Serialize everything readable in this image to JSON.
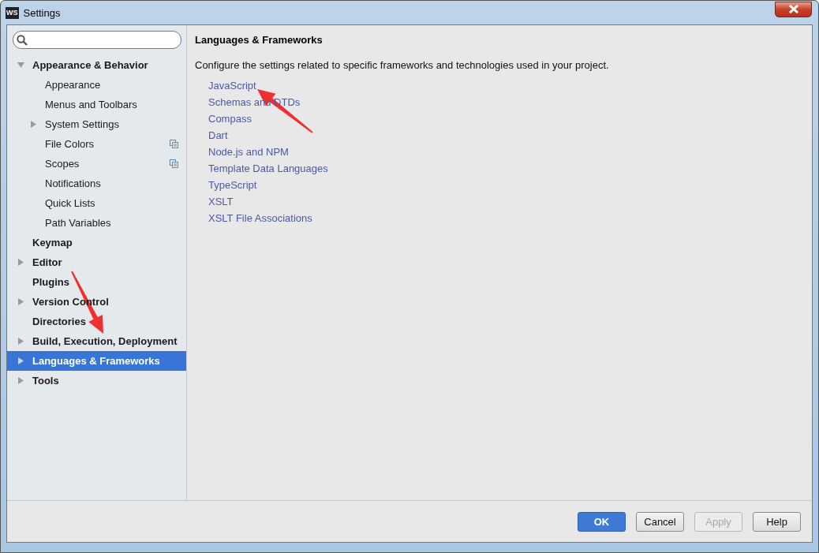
{
  "window": {
    "title": "Settings",
    "app_icon": "WS"
  },
  "sidebar": {
    "items": [
      {
        "label": "Appearance & Behavior",
        "kind": "group",
        "expanded": true,
        "selected": false,
        "children": [
          {
            "label": "Appearance",
            "kind": "leaf",
            "project_icon": false,
            "selected": false
          },
          {
            "label": "Menus and Toolbars",
            "kind": "leaf",
            "project_icon": false,
            "selected": false
          },
          {
            "label": "System Settings",
            "kind": "group",
            "expanded": false,
            "project_icon": false,
            "selected": false
          },
          {
            "label": "File Colors",
            "kind": "leaf",
            "project_icon": true,
            "selected": false
          },
          {
            "label": "Scopes",
            "kind": "leaf",
            "project_icon": true,
            "selected": false
          },
          {
            "label": "Notifications",
            "kind": "leaf",
            "project_icon": false,
            "selected": false
          },
          {
            "label": "Quick Lists",
            "kind": "leaf",
            "project_icon": false,
            "selected": false
          },
          {
            "label": "Path Variables",
            "kind": "leaf",
            "project_icon": false,
            "selected": false
          }
        ]
      },
      {
        "label": "Keymap",
        "kind": "leaf",
        "selected": false
      },
      {
        "label": "Editor",
        "kind": "group",
        "expanded": false,
        "selected": false
      },
      {
        "label": "Plugins",
        "kind": "leaf",
        "selected": false
      },
      {
        "label": "Version Control",
        "kind": "group",
        "expanded": false,
        "selected": false
      },
      {
        "label": "Directories",
        "kind": "leaf",
        "selected": false
      },
      {
        "label": "Build, Execution, Deployment",
        "kind": "group",
        "expanded": false,
        "selected": false
      },
      {
        "label": "Languages & Frameworks",
        "kind": "group",
        "expanded": false,
        "selected": true
      },
      {
        "label": "Tools",
        "kind": "group",
        "expanded": false,
        "selected": false
      }
    ]
  },
  "content": {
    "title": "Languages & Frameworks",
    "description": "Configure the settings related to specific frameworks and technologies used in your project.",
    "links": [
      "JavaScript",
      "Schemas and DTDs",
      "Compass",
      "Dart",
      "Node.js and NPM",
      "Template Data Languages",
      "TypeScript",
      "XSLT",
      "XSLT File Associations"
    ]
  },
  "buttons": [
    {
      "label": "OK",
      "kind": "default",
      "disabled": false
    },
    {
      "label": "Cancel",
      "kind": "normal",
      "disabled": false
    },
    {
      "label": "Apply",
      "kind": "normal",
      "disabled": true
    },
    {
      "label": "Help",
      "kind": "normal",
      "disabled": false
    }
  ]
}
